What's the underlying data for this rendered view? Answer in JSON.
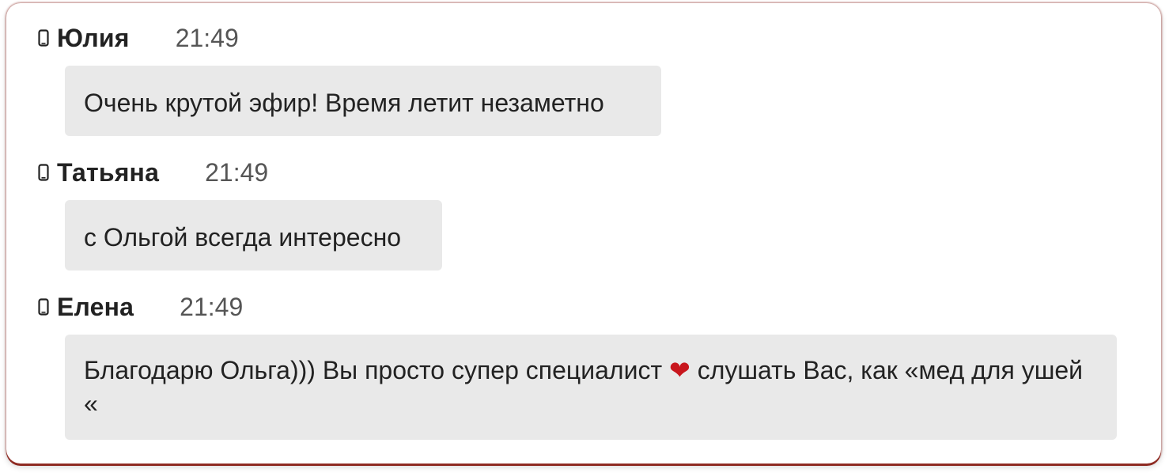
{
  "messages": [
    {
      "icon": "phone-icon",
      "author": "Юлия",
      "time": "21:49",
      "text": "Очень крутой эфир! Время летит незаметно"
    },
    {
      "icon": "phone-icon",
      "author": "Татьяна",
      "time": "21:49",
      "text": "с Ольгой всегда интересно"
    },
    {
      "icon": "phone-icon",
      "author": "Елена",
      "time": "21:49",
      "text_before": "Благодарю Ольга))) Вы просто супер специалист",
      "emoji": "❤",
      "text_after": "слушать Вас, как «мед для ушей «"
    }
  ],
  "colors": {
    "bubble_bg": "#e9e9e9",
    "card_border": "#8e2a22",
    "author": "#222222",
    "time": "#555555"
  }
}
